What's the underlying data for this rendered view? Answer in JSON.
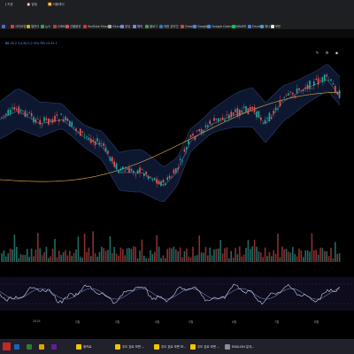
{
  "bookmarks": [
    {
      "label": "",
      "color": "#4b6bd8"
    },
    {
      "label": "사이트맵",
      "color": "#e23a3a"
    },
    {
      "label": "캘린더",
      "color": "#e1b000"
    },
    {
      "label": "뉴스",
      "color": "#3aa04a"
    },
    {
      "label": "CMBC",
      "color": "#c03a3a"
    },
    {
      "label": "선물옵션",
      "color": "#e05050"
    },
    {
      "label": "YouTube Music",
      "color": "#e03030"
    },
    {
      "label": "iCloud",
      "color": "#aaaaaa"
    },
    {
      "label": "공유",
      "color": "#6a8fe0"
    },
    {
      "label": "해외",
      "color": "#6a8fe0"
    },
    {
      "label": "블로그",
      "color": "#3aa04a"
    },
    {
      "label": "대한 온라인",
      "color": "#3a70c8"
    },
    {
      "label": "Gmail",
      "color": "#d44638"
    },
    {
      "label": "Google",
      "color": "#4285f4"
    },
    {
      "label": "Google Calendar",
      "color": "#4285f4"
    },
    {
      "label": "NAVER",
      "color": "#03c75a"
    },
    {
      "label": "Daum",
      "color": "#4a7ae0"
    },
    {
      "label": "에너",
      "color": "#3aa0e0"
    },
    {
      "label": "모든",
      "color": "#e6e6e6"
    }
  ],
  "toolbar": {
    "items": [
      "지표",
      "알림",
      "리플레이"
    ],
    "legend_text": "BB 20 2  3,4,50,5,2  VOL  RSI 14  41.7"
  },
  "right_icons": [
    "draw-icon",
    "settings-icon",
    "camera-icon",
    "fullscreen-icon"
  ],
  "time_axis": [
    "2024",
    "2월",
    "3월",
    "4월",
    "5월",
    "6월",
    "7월",
    "8월"
  ],
  "taskbar": {
    "items": [
      {
        "label": "",
        "color": "#1565c0"
      },
      {
        "label": "",
        "color": "#2e7d32"
      },
      {
        "label": "",
        "color": "#e0a000"
      },
      {
        "label": "",
        "color": "#6a1b9a"
      },
      {
        "label": "위키로",
        "color": "#f5c400"
      },
      {
        "label": "주도 호르 보면 ...",
        "color": "#f5c400"
      },
      {
        "label": "주도 호르 보면 보...",
        "color": "#f5c400"
      },
      {
        "label": "주도 호르 보면 ...",
        "color": "#f5c400"
      },
      {
        "label": "ENGLISH 분석...",
        "color": "#8e8e8e"
      }
    ]
  },
  "colors": {
    "up": "#26a69a",
    "down": "#ef5350",
    "band": "#2d3f66",
    "band_fill": "#0d1730",
    "ma": "#d0a040",
    "ma2": "#8090a0",
    "rsi": "#cfd6e6",
    "rsi_signal": "#6e7fb8"
  }
}
